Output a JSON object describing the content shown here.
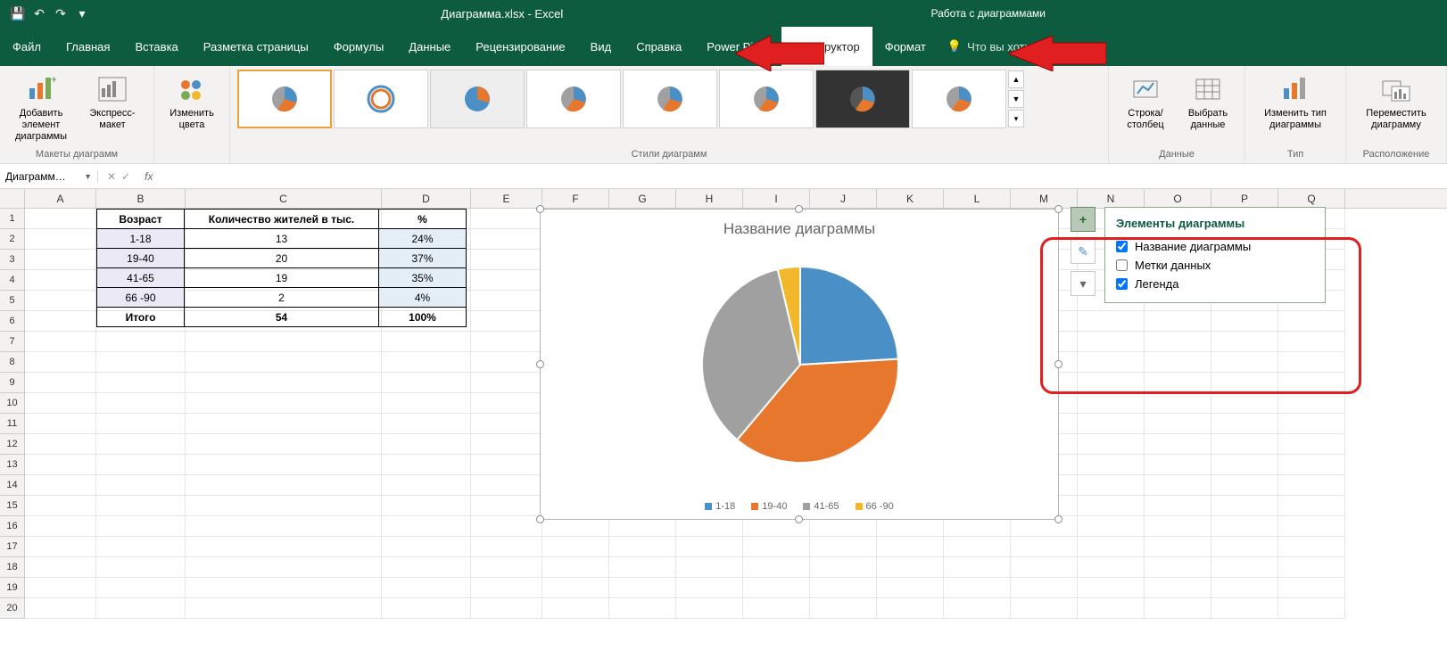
{
  "app_title": "Диаграмма.xlsx - Excel",
  "contextual_title": "Работа с диаграммами",
  "qat": {
    "save": "💾",
    "undo": "↶",
    "redo": "↷",
    "more": "▾"
  },
  "tabs": [
    "Файл",
    "Главная",
    "Вставка",
    "Разметка страницы",
    "Формулы",
    "Данные",
    "Рецензирование",
    "Вид",
    "Справка",
    "Power Pivot",
    "Конструктор",
    "Формат"
  ],
  "active_tab": 10,
  "tell_me_placeholder": "Что вы хотите сделать?",
  "ribbon": {
    "group1_label": "Макеты диаграмм",
    "add_element": "Добавить элемент диаграммы",
    "quick_layout": "Экспресс-макет",
    "change_colors": "Изменить цвета",
    "group2_label": "Стили диаграмм",
    "group3_label": "Данные",
    "switch_rc": "Строка/ столбец",
    "select_data": "Выбрать данные",
    "group4_label": "Тип",
    "change_type": "Изменить тип диаграммы",
    "group5_label": "Расположение",
    "move_chart": "Переместить диаграмму"
  },
  "namebox": "Диаграмм…",
  "columns": [
    "A",
    "B",
    "C",
    "D",
    "E",
    "F",
    "G",
    "H",
    "I",
    "J",
    "K",
    "L",
    "M",
    "N",
    "O",
    "P",
    "Q"
  ],
  "rownums": [
    1,
    2,
    3,
    4,
    5,
    6,
    7,
    8,
    9,
    10,
    11,
    12,
    13,
    14,
    15,
    16,
    17,
    18,
    19,
    20
  ],
  "table": {
    "headers": [
      "Возраст",
      "Количество жителей в тыс.",
      "%"
    ],
    "rows": [
      [
        "1-18",
        "13",
        "24%"
      ],
      [
        "19-40",
        "20",
        "37%"
      ],
      [
        "41-65",
        "19",
        "35%"
      ],
      [
        "66 -90",
        "2",
        "4%"
      ]
    ],
    "total": [
      "Итого",
      "54",
      "100%"
    ]
  },
  "chart_title": "Название диаграммы",
  "chart_legend": [
    "1-18",
    "19-40",
    "41-65",
    "66 -90"
  ],
  "flyout": {
    "title": "Элементы диаграммы",
    "items": [
      {
        "label": "Название диаграммы",
        "checked": true
      },
      {
        "label": "Метки данных",
        "checked": false
      },
      {
        "label": "Легенда",
        "checked": true
      }
    ]
  },
  "chart_data": {
    "type": "pie",
    "title": "Название диаграммы",
    "categories": [
      "1-18",
      "19-40",
      "41-65",
      "66 -90"
    ],
    "values": [
      13,
      20,
      19,
      2
    ],
    "percentages": [
      24,
      37,
      35,
      4
    ],
    "colors": [
      "#4a90c7",
      "#e8772e",
      "#a0a0a0",
      "#f2b72a"
    ],
    "legend_position": "bottom"
  }
}
